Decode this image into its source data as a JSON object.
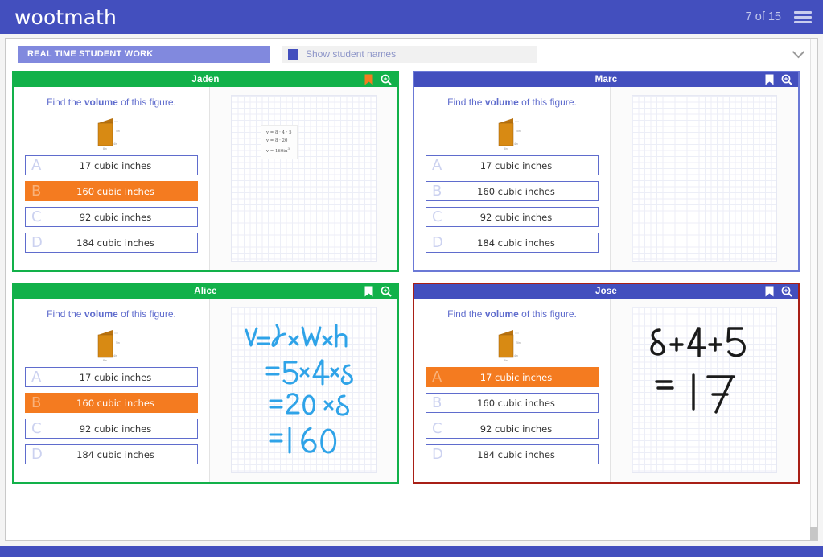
{
  "app": {
    "brand": "wootmath",
    "page_counter": "7 of 15",
    "menu_icon": "hamburger-icon",
    "accent_color": "#434fbe"
  },
  "toolbar": {
    "tab_label": "REAL TIME STUDENT WORK",
    "show_names_label": "Show student names",
    "show_names_checked": true,
    "collapse_icon": "chevron-down-icon"
  },
  "question": {
    "prompt_prefix": "Find the ",
    "prompt_bold": "volume",
    "prompt_suffix": " of this figure.",
    "figure": "orange-rectangular-prism"
  },
  "options_letters": [
    "A",
    "B",
    "C",
    "D"
  ],
  "options_text": [
    "17 cubic inches",
    "160 cubic inches",
    "92 cubic inches",
    "184 cubic inches"
  ],
  "colors": {
    "selected": "#f47b20",
    "option_border": "#5f6ccd",
    "header_blue": "#434fbe",
    "correct_green": "#12b14a",
    "incorrect_red": "#a81f16",
    "neutral_blue": "#6b79d6"
  },
  "cards": [
    {
      "name": "Jaden",
      "border_style": "b-green",
      "header_style": "green",
      "selected_index": 1,
      "bookmarked": true,
      "bookmark_color": "#f47b20",
      "work_type": "typed",
      "work_lines": [
        "v = 8 · 4 · 5",
        "v = 8 · 20",
        "v = 160in",
        "3"
      ]
    },
    {
      "name": "Marc",
      "border_style": "b-blue",
      "header_style": "blue",
      "selected_index": -1,
      "bookmarked": true,
      "bookmark_color": "#ffffff",
      "work_type": "none",
      "work_lines": []
    },
    {
      "name": "Alice",
      "border_style": "b-green",
      "header_style": "blue",
      "selected_index": 1,
      "bookmarked": true,
      "bookmark_color": "#ffffff",
      "work_type": "handwriting-blue",
      "work_lines": [
        "V= l x W x h",
        "= 5x4x8",
        "= 20 x 8",
        "= 160"
      ]
    },
    {
      "name": "Jose",
      "border_style": "b-red",
      "header_style": "blue",
      "selected_index": 0,
      "bookmarked": true,
      "bookmark_color": "#ffffff",
      "work_type": "handwriting-black",
      "work_lines": [
        "8+4+5",
        "= 17"
      ]
    }
  ]
}
